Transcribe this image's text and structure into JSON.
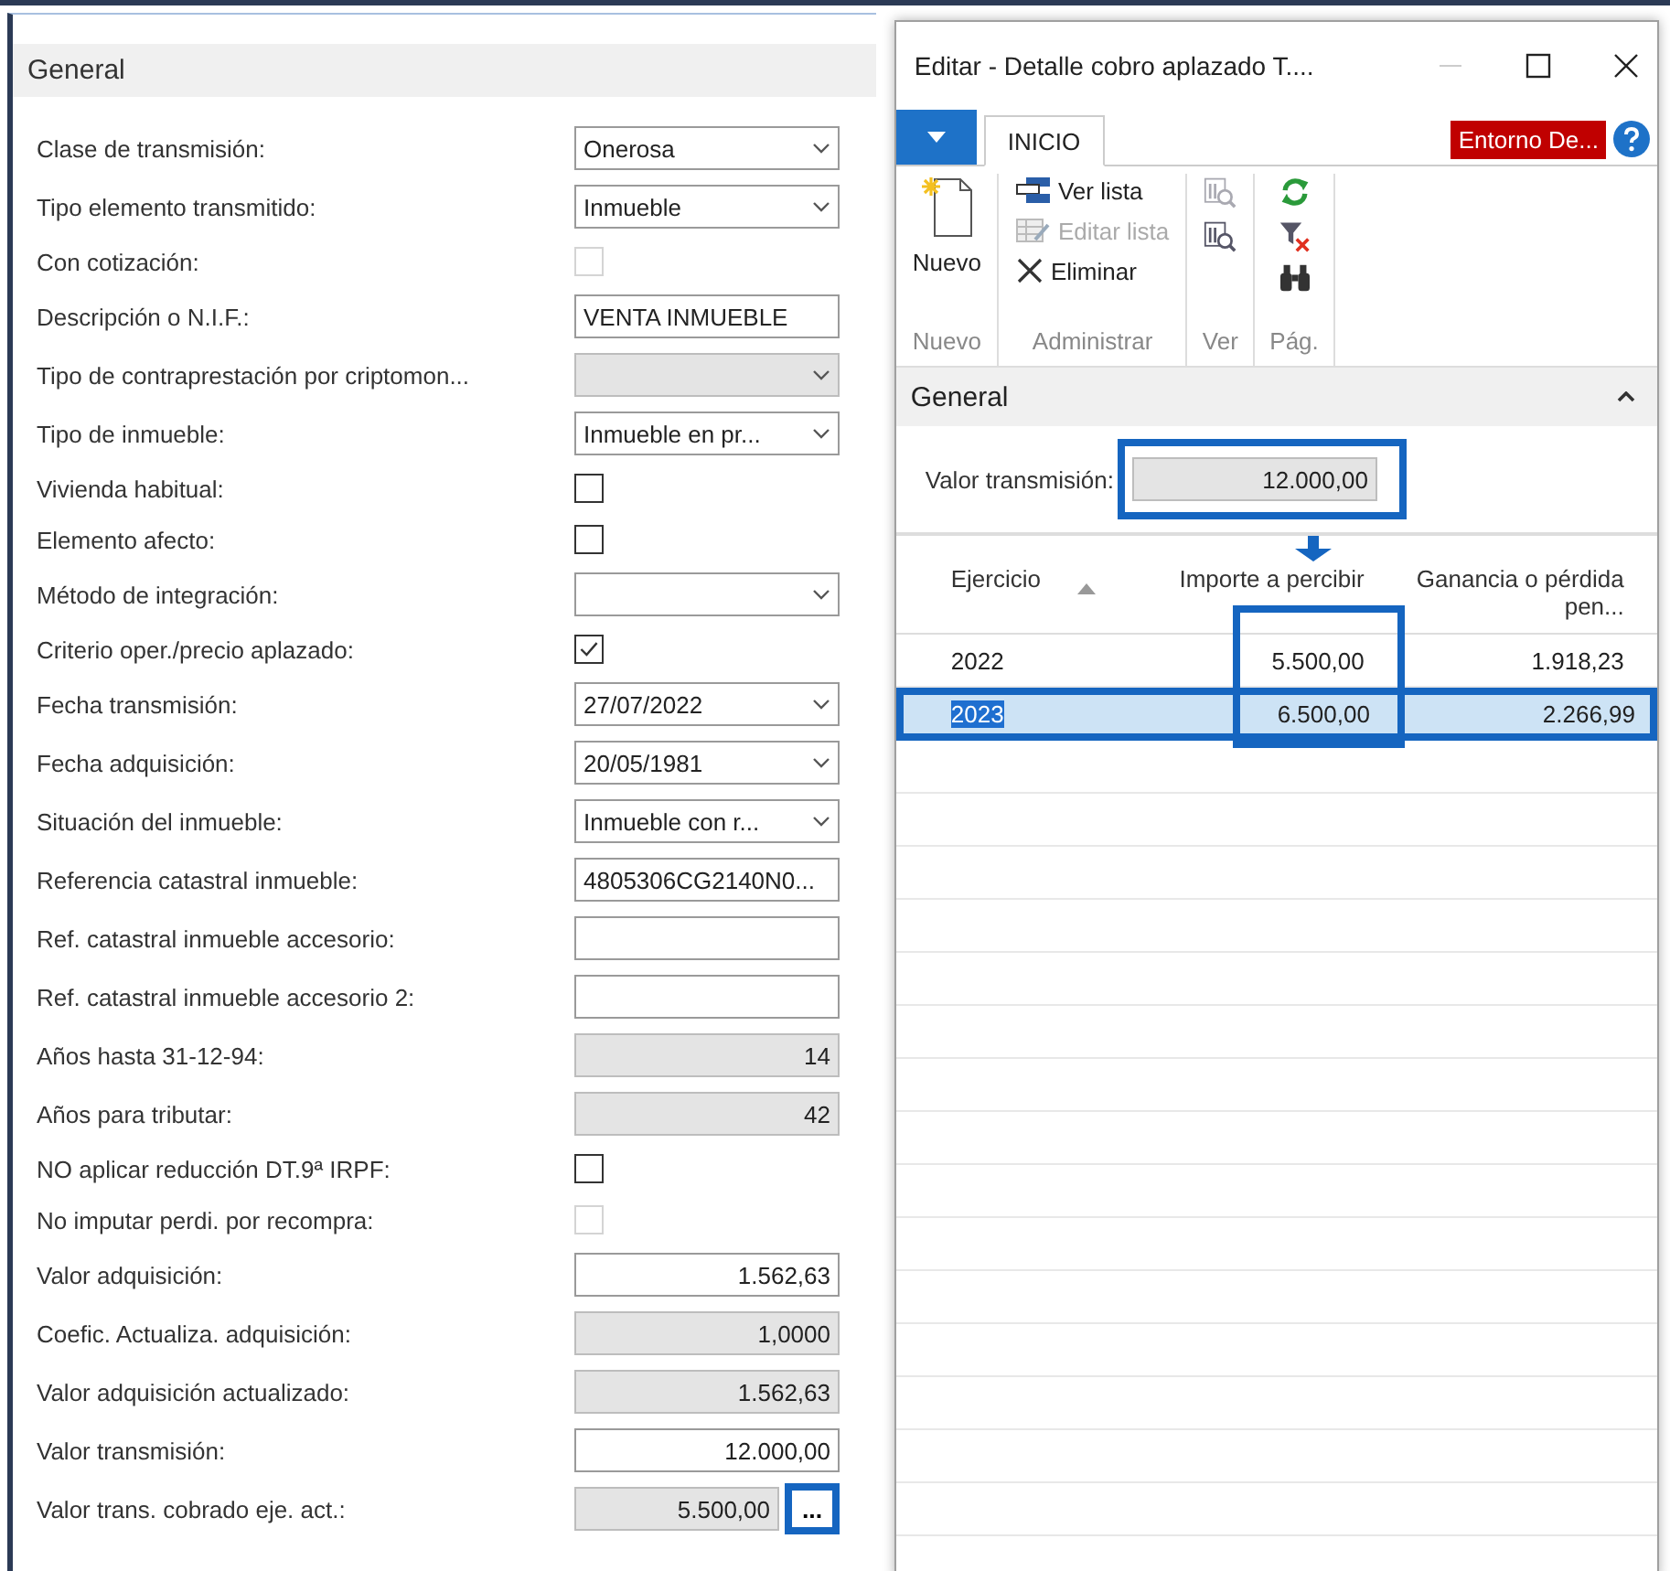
{
  "panel": {
    "title": "General",
    "fields": [
      {
        "label": "Clase de transmisión:",
        "kind": "select",
        "value": "Onerosa",
        "editable": true
      },
      {
        "label": "Tipo elemento transmitido:",
        "kind": "select",
        "value": "Inmueble",
        "editable": true
      },
      {
        "label": "Con cotización:",
        "kind": "checkbox",
        "checked": false,
        "disabled": true
      },
      {
        "label": "Descripción o N.I.F.:",
        "kind": "text",
        "value": "VENTA INMUEBLE",
        "editable": true
      },
      {
        "label": "Tipo de contraprestación por criptomon...",
        "kind": "select",
        "editable": false
      },
      {
        "label": "Tipo de inmueble:",
        "kind": "select",
        "value": "Inmueble en pr...",
        "editable": true
      },
      {
        "label": "Vivienda habitual:",
        "kind": "checkbox",
        "checked": false,
        "disabled": false
      },
      {
        "label": "Elemento afecto:",
        "kind": "checkbox",
        "checked": false,
        "disabled": false
      },
      {
        "label": "Método de integración:",
        "kind": "select",
        "editable": true
      },
      {
        "label": "Criterio oper./precio aplazado:",
        "kind": "checkbox",
        "checked": true,
        "disabled": false
      },
      {
        "label": "Fecha transmisión:",
        "kind": "select",
        "value": "27/07/2022",
        "editable": true
      },
      {
        "label": "Fecha adquisición:",
        "kind": "select",
        "value": "20/05/1981",
        "editable": true
      },
      {
        "label": "Situación del inmueble:",
        "kind": "select",
        "value": "Inmueble con r...",
        "editable": true
      },
      {
        "label": "Referencia catastral inmueble:",
        "kind": "text",
        "value": "4805306CG2140N0...",
        "editable": true
      },
      {
        "label": "Ref. catastral inmueble accesorio:",
        "kind": "text",
        "editable": true
      },
      {
        "label": "Ref. catastral inmueble accesorio 2:",
        "kind": "text",
        "editable": true
      },
      {
        "label": "Años hasta 31-12-94:",
        "kind": "number",
        "value": "14",
        "editable": false
      },
      {
        "label": "Años para tributar:",
        "kind": "number",
        "value": "42",
        "editable": false
      },
      {
        "label": "NO aplicar reducción DT.9ª IRPF:",
        "kind": "checkbox",
        "checked": false,
        "disabled": false
      },
      {
        "label": "No imputar perdi. por recompra:",
        "kind": "checkbox",
        "checked": false,
        "disabled": true
      },
      {
        "label": "Valor adquisición:",
        "kind": "number",
        "value": "1.562,63",
        "editable": true
      },
      {
        "label": "Coefic. Actualiza. adquisición:",
        "kind": "number",
        "value": "1,0000",
        "editable": false
      },
      {
        "label": "Valor adquisición actualizado:",
        "kind": "number",
        "value": "1.562,63",
        "editable": false
      },
      {
        "label": "Valor transmisión:",
        "kind": "number",
        "value": "12.000,00",
        "editable": true
      },
      {
        "label": "Valor trans. cobrado eje. act.:",
        "kind": "lookup",
        "value": "5.500,00",
        "editable": false,
        "button": "...",
        "highlighted": true
      }
    ]
  },
  "dialog": {
    "title": "Editar - Detalle cobro aplazado T....",
    "tabs": [
      {
        "label": "INICIO",
        "selected": true
      }
    ],
    "environment_badge": "Entorno De...",
    "ribbon": [
      {
        "group": "Nuevo",
        "kind": "large",
        "actions": [
          {
            "label": "Nuevo",
            "disabled": false
          }
        ]
      },
      {
        "group": "Administrar",
        "kind": "list",
        "actions": [
          {
            "label": "Ver lista",
            "disabled": false
          },
          {
            "label": "Editar lista",
            "disabled": true
          },
          {
            "label": "Eliminar",
            "disabled": false
          }
        ]
      },
      {
        "group": "Ver",
        "kind": "icons",
        "actions": [
          {
            "disabled": true
          },
          {
            "disabled": false
          }
        ]
      },
      {
        "group": "Pág.",
        "kind": "icons",
        "actions": [
          {
            "disabled": false
          },
          {
            "disabled": false
          },
          {
            "disabled": false
          }
        ]
      }
    ],
    "section": {
      "title": "General",
      "expanded": true
    },
    "field": {
      "label": "Valor transmisión:",
      "value": "12.000,00",
      "highlighted": true
    },
    "table": {
      "columns": [
        {
          "label": "Ejercicio",
          "sorted": true,
          "highlighted": false
        },
        {
          "label": "Importe a percibir",
          "sorted": false,
          "highlighted": true
        },
        {
          "label": "Ganancia o pérdida pen...",
          "sorted": false,
          "highlighted": false
        }
      ],
      "rows": [
        {
          "cells": [
            "2022",
            "5.500,00",
            "1.918,23"
          ],
          "selected": false,
          "highlighted": false
        },
        {
          "cells": [
            "2023",
            "6.500,00",
            "2.266,99"
          ],
          "selected": true,
          "highlighted": true
        }
      ]
    }
  }
}
